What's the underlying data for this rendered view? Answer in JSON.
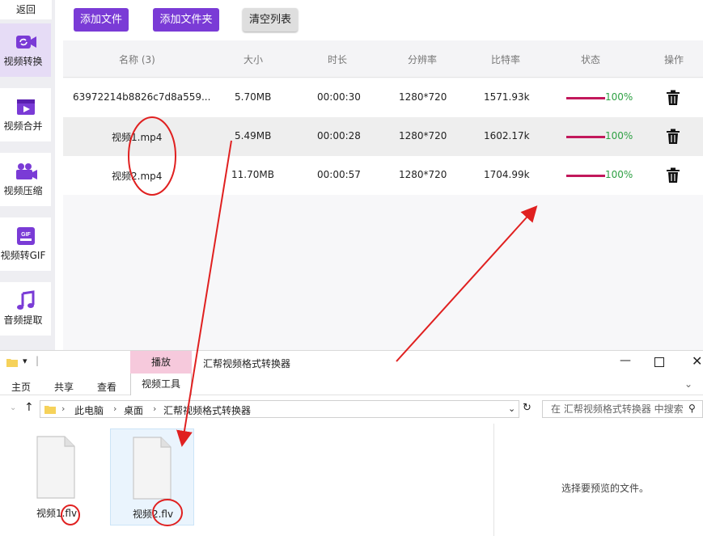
{
  "app": {
    "back_label": "返回",
    "nav": [
      {
        "label": "视频转换",
        "active": true
      },
      {
        "label": "视频合并"
      },
      {
        "label": "视频压缩"
      },
      {
        "label": "视频转GIF",
        "badge": "GIF"
      },
      {
        "label": "音频提取"
      }
    ],
    "toolbar": {
      "add_file": "添加文件",
      "add_folder": "添加文件夹",
      "clear_list": "清空列表"
    },
    "table": {
      "headers": [
        "名称 (3)",
        "大小",
        "时长",
        "分辨率",
        "比特率",
        "状态",
        "操作"
      ],
      "rows": [
        {
          "name": "63972214b8826c7d8a559...",
          "size": "5.70MB",
          "duration": "00:00:30",
          "resolution": "1280*720",
          "bitrate": "1571.93k",
          "progress": 100,
          "status": "100%"
        },
        {
          "name": "视频1.mp4",
          "size": "5.49MB",
          "duration": "00:00:28",
          "resolution": "1280*720",
          "bitrate": "1602.17k",
          "progress": 100,
          "status": "100%"
        },
        {
          "name": "视频2.mp4",
          "size": "11.70MB",
          "duration": "00:00:57",
          "resolution": "1280*720",
          "bitrate": "1704.99k",
          "progress": 100,
          "status": "100%"
        }
      ]
    }
  },
  "explorer": {
    "title": "汇帮视频格式转换器",
    "play_tab": "播放",
    "ribbon_tabs": [
      "主页",
      "共享",
      "查看"
    ],
    "video_tools_tab": "视频工具",
    "breadcrumb": [
      "此电脑",
      "桌面",
      "汇帮视频格式转换器"
    ],
    "search_placeholder": "在 汇帮视频格式转换器 中搜索",
    "files": [
      {
        "name": "视频1.flv"
      },
      {
        "name": "视频2.flv",
        "selected": true
      }
    ],
    "preview_message": "选择要预览的文件。"
  },
  "colors": {
    "accent": "#7a3bd6",
    "progress": "#c2185b",
    "status_text": "#2ea043",
    "annotation": "#e02020"
  }
}
